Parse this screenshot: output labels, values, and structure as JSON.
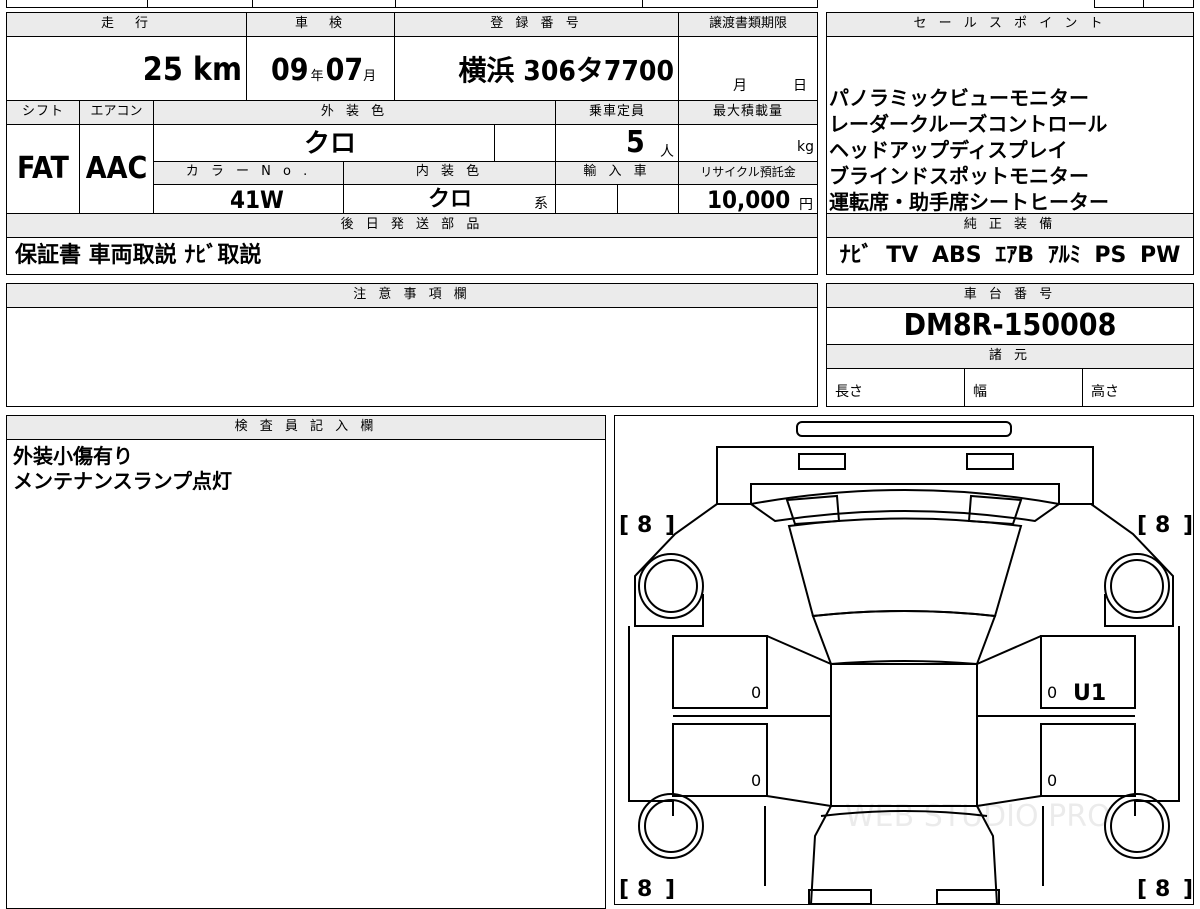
{
  "labels": {
    "mileage": "走　行",
    "inspection": "車　検",
    "registration": "登 録 番 号",
    "transfer_deadline": "譲渡書類期限",
    "shift": "シフト",
    "aircon": "エアコン",
    "exterior_color": "外 装 色",
    "capacity": "乗車定員",
    "max_load": "最大積載量",
    "color_no": "カ ラ ー N o .",
    "interior_color": "内 装 色",
    "import": "輸 入 車",
    "recycle_fee": "リサイクル預託金",
    "later_parts": "後 日 発 送 部 品",
    "sales_points": "セ ー ル ス ポ イ ン ト",
    "standard_equipment": "純 正 装 備",
    "notes": "注 意 事 項 欄",
    "chassis_no": "車 台 番 号",
    "specs": "諸 元",
    "inspector": "検 査 員 記 入 欄"
  },
  "values": {
    "mileage": "25",
    "mileage_unit": "km",
    "inspection_year": "09",
    "year_unit": "年",
    "inspection_month": "07",
    "month_unit": "月",
    "registration": "横浜 306タ7700",
    "deadline_month": "月",
    "deadline_day": "日",
    "shift": "FAT",
    "aircon": "AAC",
    "exterior_color": "クロ",
    "capacity": "5",
    "capacity_unit": "人",
    "max_load_unit": "kg",
    "color_no": "41W",
    "interior_color": "クロ",
    "interior_suffix": "系",
    "recycle_fee": "10,000",
    "recycle_unit": "円",
    "later_parts": "保証書 車両取説 ﾅﾋﾞ取説",
    "standard_equipment": "ﾅﾋﾞ TV ABS ｴｱB ｱﾙﾐ PS PW",
    "chassis_no": "DM8R-150008",
    "length": "長さ",
    "width": "幅",
    "height": "高さ"
  },
  "sales_points": [
    "パノラミックビューモニター",
    "レーダークルーズコントロール",
    "ヘッドアップディスプレイ",
    "ブラインドスポットモニター",
    "運転席・助手席シートヒーター"
  ],
  "inspector_notes": [
    "外装小傷有り",
    "メンテナンスランプ点灯"
  ],
  "diagram": {
    "tire_fl": "8",
    "tire_fr": "8",
    "tire_rl": "8",
    "tire_rr": "8",
    "door_fl": "0",
    "door_rl": "0",
    "door_fr": "0",
    "door_rr": "0",
    "mark_fr": "U1",
    "watermark": "WEB STUDIO PRO"
  }
}
